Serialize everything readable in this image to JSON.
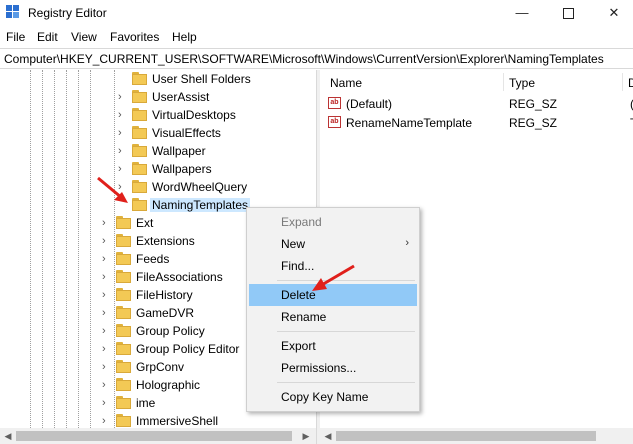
{
  "window": {
    "title": "Registry Editor",
    "min": "—",
    "close": "✕"
  },
  "menu": [
    "File",
    "Edit",
    "View",
    "Favorites",
    "Help"
  ],
  "address": "Computer\\HKEY_CURRENT_USER\\SOFTWARE\\Microsoft\\Windows\\CurrentVersion\\Explorer\\NamingTemplates",
  "tree": {
    "items": [
      {
        "label": "User Shell Folders"
      },
      {
        "label": "UserAssist"
      },
      {
        "label": "VirtualDesktops"
      },
      {
        "label": "VisualEffects"
      },
      {
        "label": "Wallpaper"
      },
      {
        "label": "Wallpapers"
      },
      {
        "label": "WordWheelQuery"
      },
      {
        "label": "NamingTemplates"
      },
      {
        "label": "Ext"
      },
      {
        "label": "Extensions"
      },
      {
        "label": "Feeds"
      },
      {
        "label": "FileAssociations"
      },
      {
        "label": "FileHistory"
      },
      {
        "label": "GameDVR"
      },
      {
        "label": "Group Policy"
      },
      {
        "label": "Group Policy Editor"
      },
      {
        "label": "GrpConv"
      },
      {
        "label": "Holographic"
      },
      {
        "label": "ime"
      },
      {
        "label": "ImmersiveShell"
      }
    ]
  },
  "values": {
    "columns": {
      "name": "Name",
      "type": "Type",
      "data": "D"
    },
    "rows": [
      {
        "icon": "ab",
        "name": "(Default)",
        "type": "REG_SZ",
        "data": "("
      },
      {
        "icon": "ab",
        "name": "RenameNameTemplate",
        "type": "REG_SZ",
        "data": "T"
      }
    ]
  },
  "context_menu": {
    "items": [
      "Expand",
      "New",
      "Find...",
      "Delete",
      "Rename",
      "Export",
      "Permissions...",
      "Copy Key Name"
    ],
    "submenu_arrow": "›"
  },
  "colors": {
    "highlight": "#91c9f7",
    "selected": "#cde8ff",
    "folder": "#f3c955",
    "annotation": "#e0201b"
  }
}
